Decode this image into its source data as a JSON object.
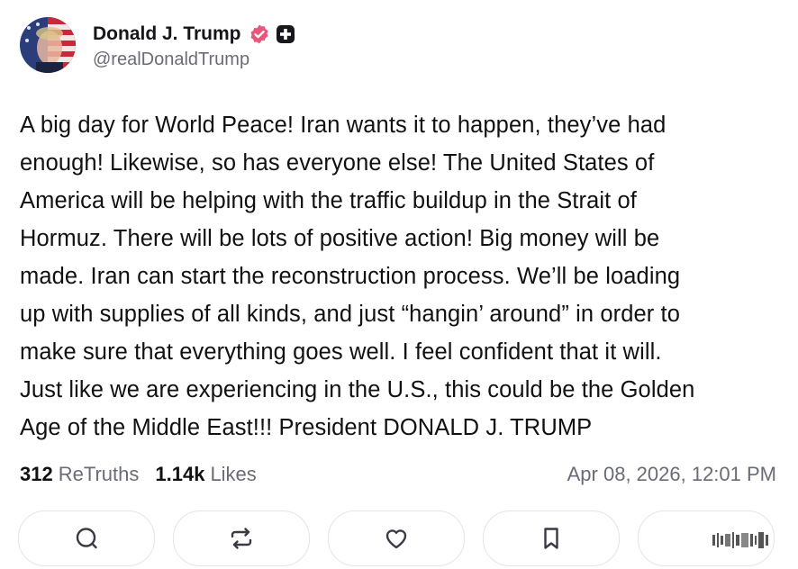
{
  "post": {
    "author": {
      "display_name": "Donald J. Trump",
      "handle": "@realDonaldTrump",
      "verified_badge": "verified-badge-icon",
      "extra_badge": "plus-badge-icon",
      "badge_color": "#e8567a"
    },
    "body_lines": [
      "A big day for World Peace! Iran wants it to happen, they’ve had",
      "enough! Likewise, so has everyone else! The United States of",
      "America will be helping with the traffic buildup in the Strait of",
      "Hormuz. There will be lots of positive action! Big money will be",
      "made. Iran can start the reconstruction process. We’ll be loading",
      "up with supplies of all kinds, and just “hangin’ around” in order to",
      "make sure that everything goes well. I feel confident that it will.",
      "Just like we are experiencing in the U.S., this could be the Golden",
      "Age of the Middle East!!! President DONALD J. TRUMP"
    ],
    "stats": {
      "retruths_count": "312",
      "retruths_label": "ReTruths",
      "likes_count": "1.14k",
      "likes_label": "Likes"
    },
    "timestamp": "Apr 08, 2026, 12:01 PM",
    "actions": [
      {
        "name": "reply-button",
        "icon": "comment-icon"
      },
      {
        "name": "retruth-button",
        "icon": "repost-icon"
      },
      {
        "name": "like-button",
        "icon": "heart-icon"
      },
      {
        "name": "bookmark-button",
        "icon": "bookmark-icon"
      },
      {
        "name": "more-button",
        "icon": "watermark-overlay"
      }
    ]
  }
}
